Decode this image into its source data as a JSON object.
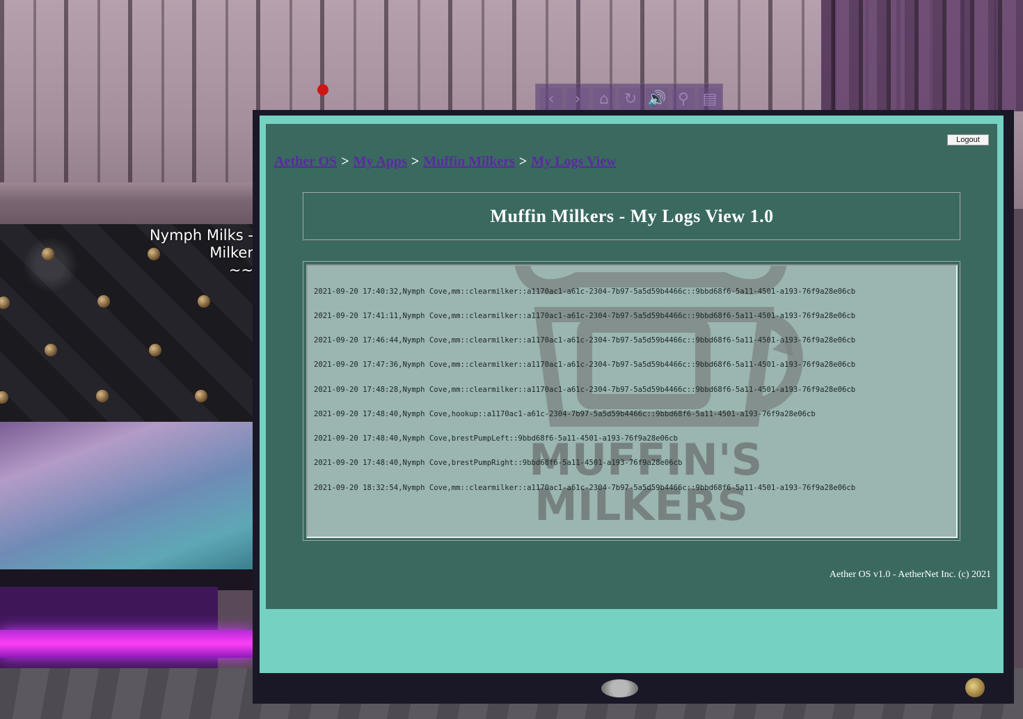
{
  "scene": {
    "floating_text_lines": [
      "Nymph Milks -",
      "Milker",
      "~~"
    ]
  },
  "nav_toolbar": {
    "buttons": [
      {
        "icon": "back-arrow-icon",
        "glyph": "‹"
      },
      {
        "icon": "forward-arrow-icon",
        "glyph": "›"
      },
      {
        "icon": "home-icon",
        "glyph": "⌂"
      },
      {
        "icon": "reload-icon",
        "glyph": "↻"
      },
      {
        "icon": "volume-icon",
        "glyph": "🔊"
      },
      {
        "icon": "zoom-icon",
        "glyph": "⚲"
      },
      {
        "icon": "media-settings-icon",
        "glyph": "▤"
      }
    ]
  },
  "app": {
    "logout_label": "Logout",
    "breadcrumb": [
      "Aether OS",
      "My Apps",
      "Muffin Milkers",
      "My Logs View"
    ],
    "breadcrumb_separator": ">",
    "title": "Muffin Milkers - My Logs View 1.0",
    "watermark_text_line1": "MUFFIN'S",
    "watermark_text_line2": "MILKERS",
    "log_lines": [
      "2021-09-20 17:40:32,Nymph Cove,mm::clearmilker::a1170ac1-a61c-2304-7b97-5a5d59b4466c::9bbd68f6-5a11-4501-a193-76f9a28e06cb",
      "2021-09-20 17:41:11,Nymph Cove,mm::clearmilker::a1170ac1-a61c-2304-7b97-5a5d59b4466c::9bbd68f6-5a11-4501-a193-76f9a28e06cb",
      "2021-09-20 17:46:44,Nymph Cove,mm::clearmilker::a1170ac1-a61c-2304-7b97-5a5d59b4466c::9bbd68f6-5a11-4501-a193-76f9a28e06cb",
      "2021-09-20 17:47:36,Nymph Cove,mm::clearmilker::a1170ac1-a61c-2304-7b97-5a5d59b4466c::9bbd68f6-5a11-4501-a193-76f9a28e06cb",
      "2021-09-20 17:48:28,Nymph Cove,mm::clearmilker::a1170ac1-a61c-2304-7b97-5a5d59b4466c::9bbd68f6-5a11-4501-a193-76f9a28e06cb",
      "2021-09-20 17:48:40,Nymph Cove,hookup::a1170ac1-a61c-2304-7b97-5a5d59b4466c::9bbd68f6-5a11-4501-a193-76f9a28e06cb",
      "2021-09-20 17:48:40,Nymph Cove,brestPumpLeft::9bbd68f6-5a11-4501-a193-76f9a28e06cb",
      "2021-09-20 17:48:40,Nymph Cove,brestPumpRight::9bbd68f6-5a11-4501-a193-76f9a28e06cb",
      "2021-09-20 18:32:54,Nymph Cove,mm::clearmilker::a1170ac1-a61c-2304-7b97-5a5d59b4466c::9bbd68f6-5a11-4501-a193-76f9a28e06cb"
    ],
    "footer": "Aether OS v1.0 - AetherNet Inc. (c) 2021"
  },
  "colors": {
    "screen_bezel": "#75d2c3",
    "panel": "#3a6960",
    "log_bg": "#9bb5b1",
    "link": "#5b2aa0"
  }
}
